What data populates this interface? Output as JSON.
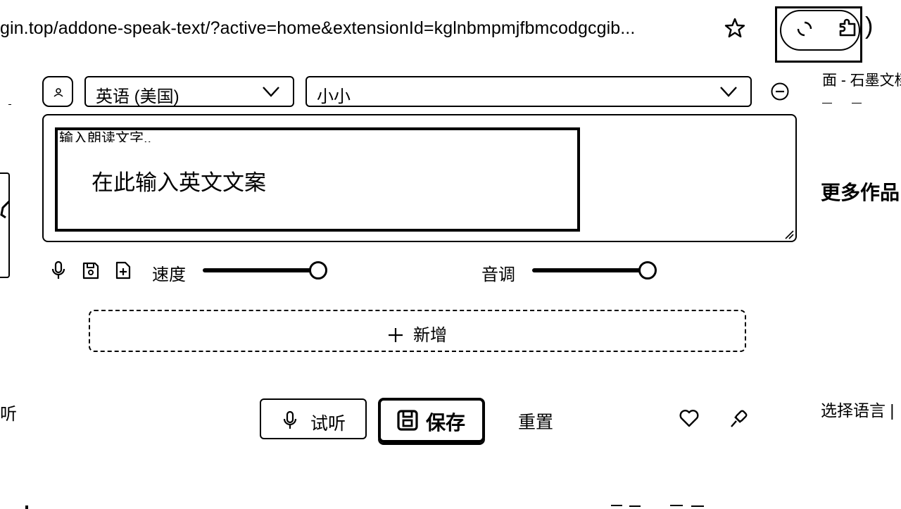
{
  "browser": {
    "url": "gin.top/addone-speak-text/?active=home&extensionId=kglnbmpmjfbmcodgcgib..."
  },
  "right_page": {
    "title": "面 - 石墨文档",
    "more": "更多作品",
    "lang": "选择语言 | "
  },
  "left_page": {
    "tab": "听"
  },
  "editor": {
    "language_select": "英语 (美国)",
    "voice_select": "小小",
    "placeholder": "输入朗读文字..",
    "highlight_text": "在此输入英文文案",
    "speed_label": "速度",
    "pitch_label": "音调",
    "speed_value": 0.92,
    "pitch_value": 0.92,
    "add_label": "新增"
  },
  "actions": {
    "listen": "试听",
    "save": "保存",
    "reset": "重置"
  }
}
